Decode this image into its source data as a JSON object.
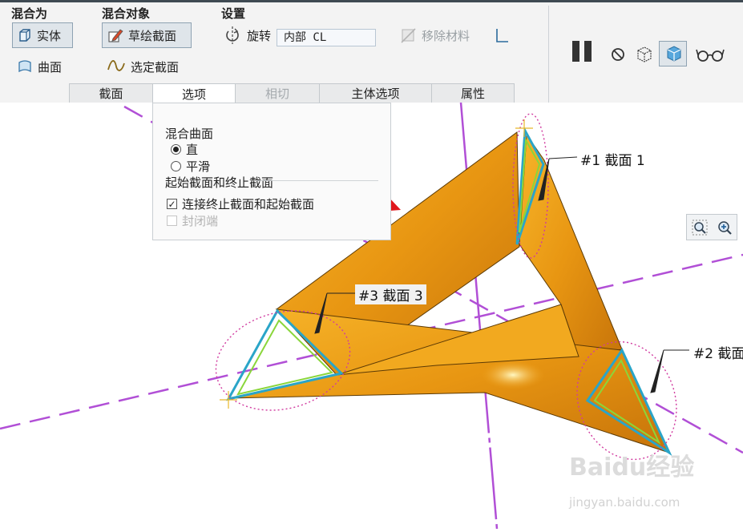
{
  "ribbon": {
    "blend_as": {
      "title": "混合为",
      "solid_label": "实体",
      "surface_label": "曲面"
    },
    "blend_with": {
      "title": "混合对象",
      "sketch_sections_label": "草绘截面",
      "selected_sections_label": "选定截面"
    },
    "settings": {
      "title": "设置",
      "rotate_label": "旋转",
      "rotate_value": "内部 CL",
      "remove_material_label": "移除材料"
    }
  },
  "tabs": [
    {
      "label": "截面"
    },
    {
      "label": "选项"
    },
    {
      "label": "相切"
    },
    {
      "label": "主体选项"
    },
    {
      "label": "属性"
    }
  ],
  "options_panel": {
    "blend_surface_title": "混合曲面",
    "straight_label": "直",
    "smooth_label": "平滑",
    "start_end_title": "起始截面和终止截面",
    "connect_label": "连接终止截面和起始截面",
    "closed_ends_label": "封闭端"
  },
  "annotations": {
    "section1": "#1 截面 1",
    "section2": "#2 截面",
    "section3": "#3 截面 3"
  },
  "watermark": {
    "logo": "Baidu经验",
    "url": "jingyan.baidu.com"
  },
  "colors": {
    "accent": "#3b6ea5",
    "geometry_orange": "#f0a31a",
    "datum_purple": "#b14fd6",
    "highlight_red": "#e0171c"
  }
}
